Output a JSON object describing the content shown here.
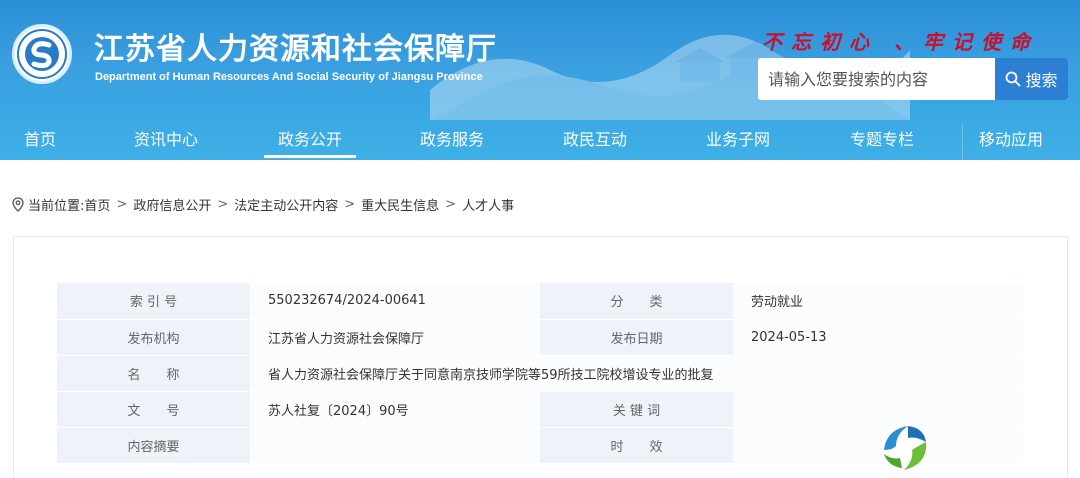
{
  "header": {
    "title": "江苏省人力资源和社会保障厅",
    "subtitle": "Department of Human Resources And Social Security of Jiangsu Province",
    "slogan": "不忘初心 、牢记使命",
    "search_placeholder": "请输入您要搜索的内容",
    "search_button": "搜索"
  },
  "nav": {
    "items": [
      {
        "label": "首页"
      },
      {
        "label": "资讯中心"
      },
      {
        "label": "政务公开"
      },
      {
        "label": "政务服务"
      },
      {
        "label": "政民互动"
      },
      {
        "label": "业务子网"
      },
      {
        "label": "专题专栏"
      },
      {
        "label": "移动应用"
      }
    ],
    "active_index": 2
  },
  "breadcrumb": {
    "prefix": "当前位置:",
    "items": [
      "首页",
      "政府信息公开",
      "法定主动公开内容",
      "重大民生信息",
      "人才人事"
    ]
  },
  "info_table": {
    "index_label": "索 引 号",
    "index_value": "550232674/2024-00641",
    "category_label": "分　　类",
    "category_value": "劳动就业",
    "publisher_label": "发布机构",
    "publisher_value": "江苏省人力资源社会保障厅",
    "date_label": "发布日期",
    "date_value": "2024-05-13",
    "name_label": "名　　称",
    "name_value": "省人力资源社会保障厅关于同意南京技师学院等59所技工院校增设专业的批复",
    "docno_label": "文　　号",
    "docno_value": "苏人社复〔2024〕90号",
    "keywords_label": "关 键 词",
    "keywords_value": "",
    "summary_label": "内容摘要",
    "summary_value": "",
    "validity_label": "时　　效",
    "validity_value": ""
  },
  "colors": {
    "header_blue": "#3a9fe0",
    "search_button": "#2d7fd4",
    "slogan_red": "#c8102e",
    "label_bg": "#eef3f9"
  }
}
